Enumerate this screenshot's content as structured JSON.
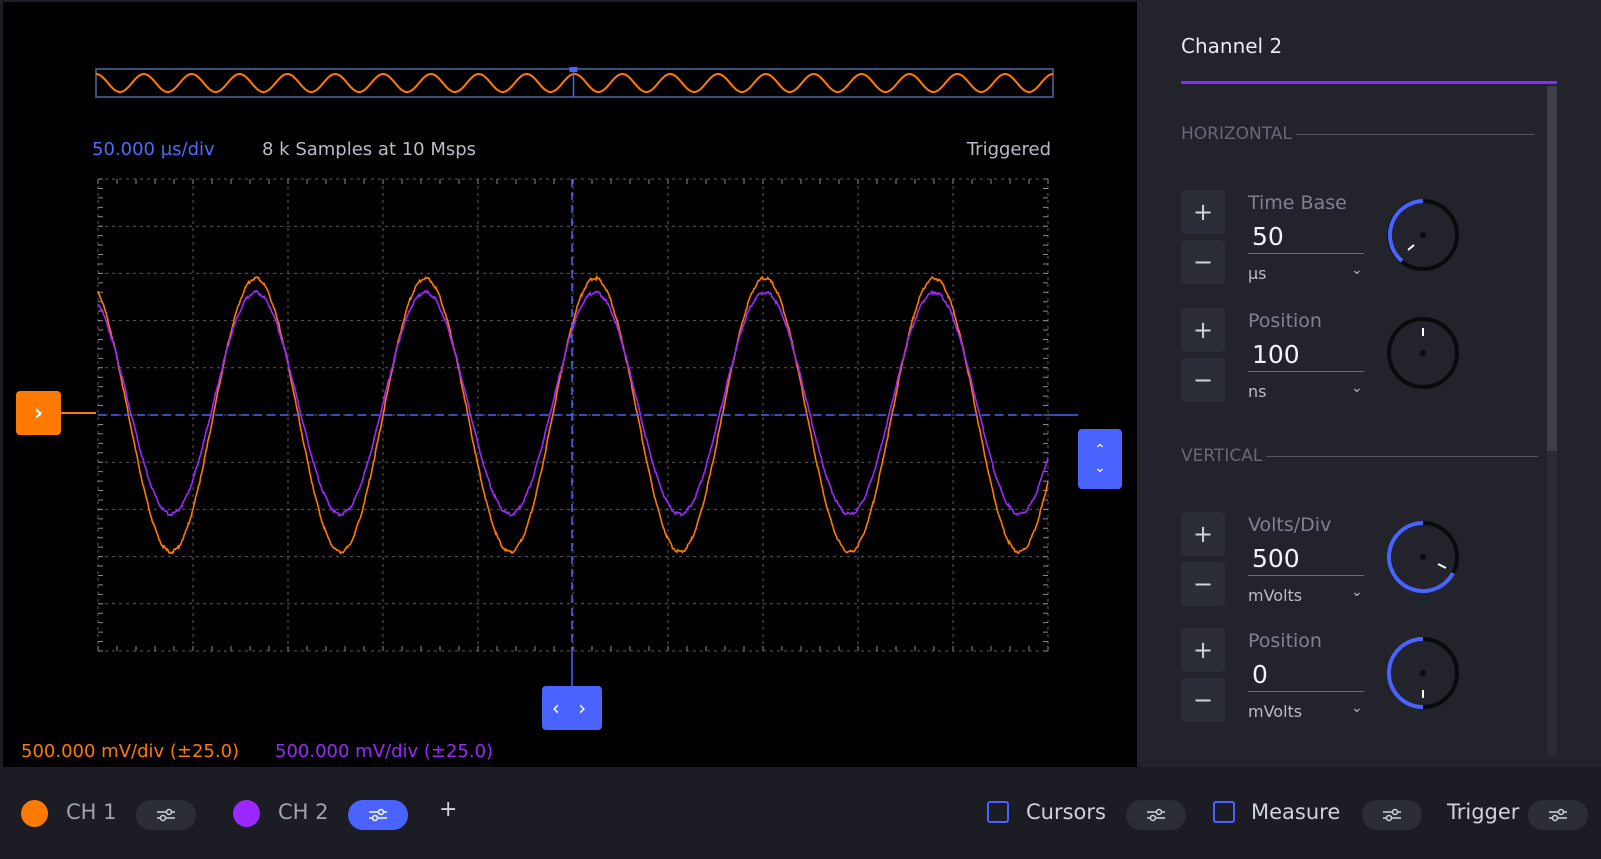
{
  "scope": {
    "timebase_label": "50.000 µs/div",
    "samples_label": "8 k Samples at 10 Msps",
    "status_label": "Triggered",
    "ch1_scale": "500.000 mV/div (±25.0)",
    "ch2_scale": "500.000 mV/div (±25.0)"
  },
  "colors": {
    "ch1": "#ff7a00",
    "ch2": "#9d28ff",
    "accent": "#4a63ff",
    "background": "#000000"
  },
  "markers": {
    "trigger_level_glyph": "›",
    "offset_up_glyph": "⌃",
    "offset_down_glyph": "⌄",
    "time_position_glyph": "‹ ›"
  },
  "panel": {
    "title": "Channel 2",
    "horizontal_header": "HORIZONTAL",
    "vertical_header": "VERTICAL",
    "controls": [
      {
        "label": "Time Base",
        "value": "50",
        "unit": "μs"
      },
      {
        "label": "Position",
        "value": "100",
        "unit": "ns"
      },
      {
        "label": "Volts/Div",
        "value": "500",
        "unit": "mVolts"
      },
      {
        "label": "Position",
        "value": "0",
        "unit": "mVolts"
      }
    ],
    "plus_glyph": "+",
    "minus_glyph": "−",
    "chevron_glyph": "⌄"
  },
  "bottom": {
    "ch1_label": "CH 1",
    "ch2_label": "CH 2",
    "add_glyph": "+",
    "cursors_label": "Cursors",
    "measure_label": "Measure",
    "trigger_label": "Trigger"
  },
  "chart_data": {
    "type": "line",
    "grid": true,
    "x_divisions": 10,
    "y_divisions": 10,
    "cycles_on_screen": 5.6,
    "series": [
      {
        "amplitude_div": 2.9,
        "offset_div": 0.0,
        "phase_cycles": 0.07,
        "color": "#ff7a00"
      },
      {
        "amplitude_div": 2.35,
        "offset_div": 0.25,
        "phase_cycles": 0.07,
        "color": "#9d28ff"
      }
    ]
  }
}
